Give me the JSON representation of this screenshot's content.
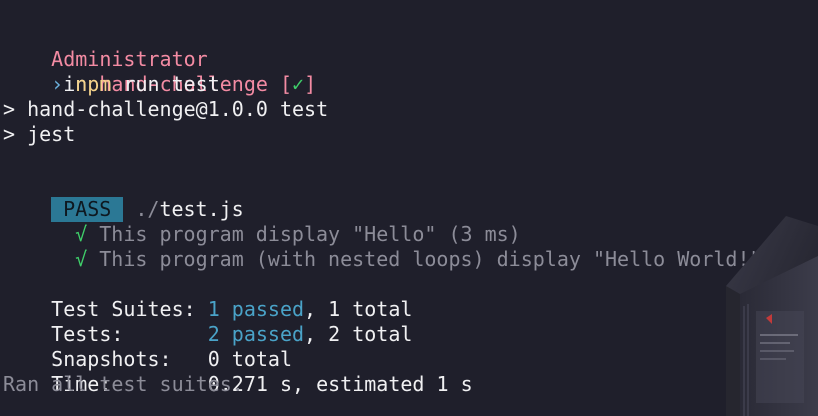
{
  "prompt": {
    "user": "Administrator",
    "in_word": "in",
    "directory": "hand-challenge",
    "status_open": "[",
    "status_mark": "✓",
    "status_close": "]",
    "symbol": "›",
    "command_bin": "npm",
    "command_args": "run test"
  },
  "script_header": {
    "line1": "> hand-challenge@1.0.0 test",
    "line2": "> jest"
  },
  "result": {
    "badge": "PASS",
    "file_prefix": "./",
    "file_name": "test.js",
    "tests": [
      {
        "mark": "√",
        "text": "This program display \"Hello\" (3 ms)"
      },
      {
        "mark": "√",
        "text": "This program (with nested loops) display \"Hello World!\" (1 ms)"
      }
    ]
  },
  "summary": {
    "suites_label": "Test Suites:",
    "suites_passed": "1 passed",
    "suites_total": ", 1 total",
    "tests_label": "Tests:",
    "tests_passed": "2 passed",
    "tests_total": ", 2 total",
    "snapshots_label": "Snapshots:",
    "snapshots_value": "0 total",
    "time_label": "Time:",
    "time_value": "0.271 s, estimated 1 s",
    "footer": "Ran all test suites."
  },
  "colors": {
    "background": "#1f1f2b",
    "prompt_user": "#f38ba3",
    "prompt_symbol": "#6db3e0",
    "command": "#f3d18a",
    "pass_badge": "#2b7895",
    "check_green": "#3fcf6a",
    "dim_text": "#8c8c98"
  },
  "icons": {
    "status_check": "check-icon",
    "decoration": "device-illustration-icon"
  }
}
